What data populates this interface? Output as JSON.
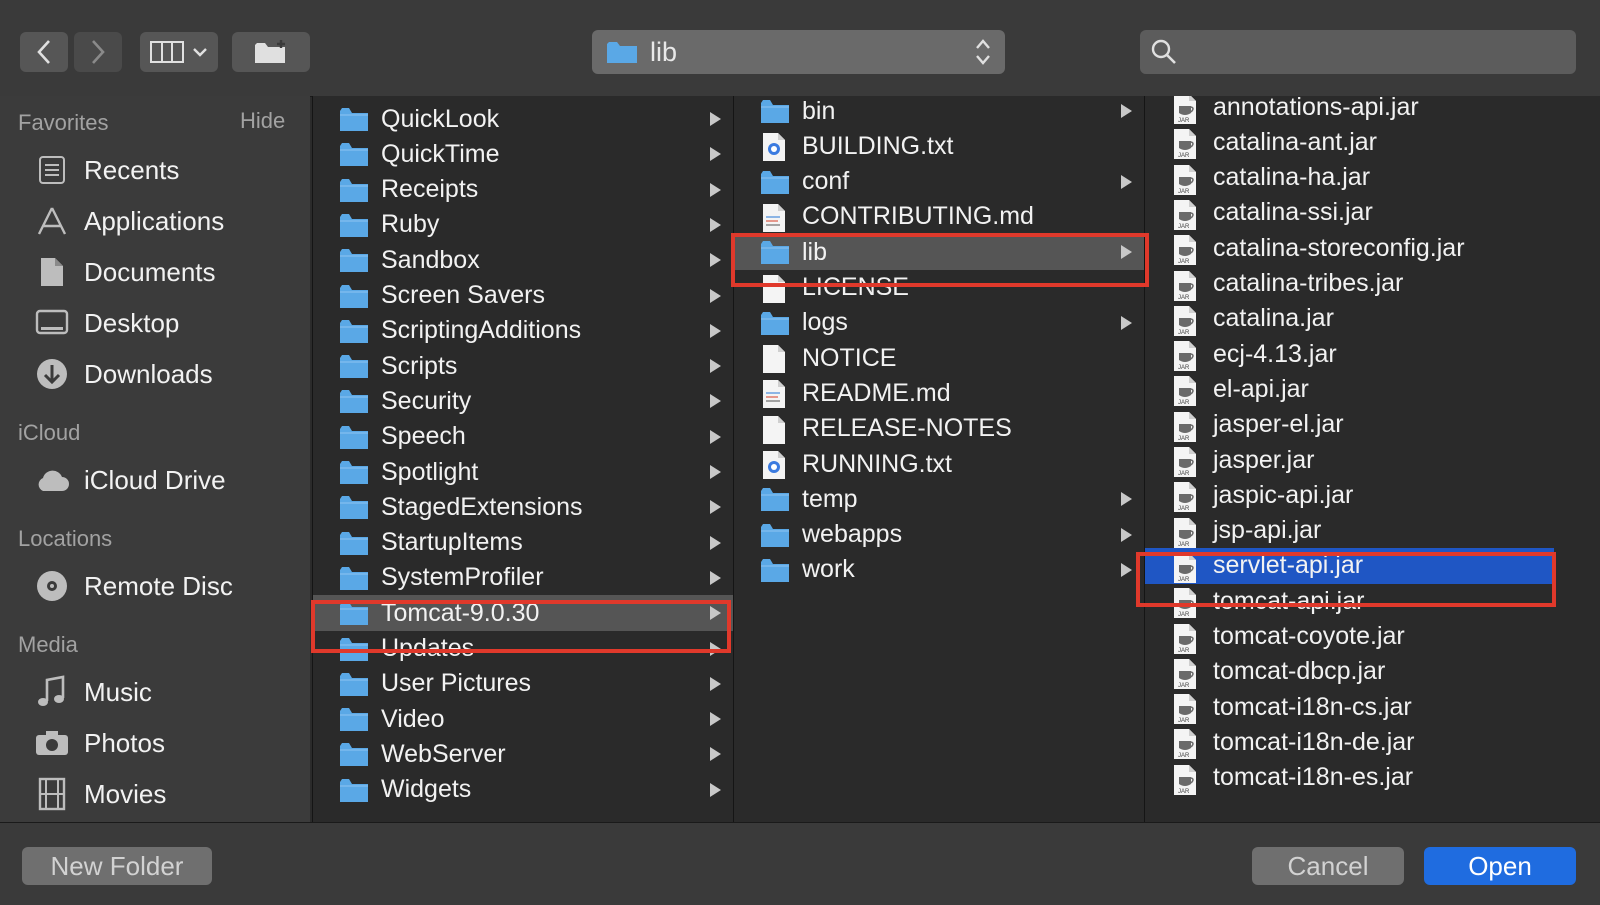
{
  "toolbar": {
    "path_label": "lib",
    "search_placeholder": ""
  },
  "sidebar": {
    "favorites_title": "Favorites",
    "hide_label": "Hide",
    "favorites": [
      {
        "label": "Recents",
        "icon": "recents-icon"
      },
      {
        "label": "Applications",
        "icon": "applications-icon"
      },
      {
        "label": "Documents",
        "icon": "documents-icon"
      },
      {
        "label": "Desktop",
        "icon": "desktop-icon"
      },
      {
        "label": "Downloads",
        "icon": "downloads-icon"
      }
    ],
    "icloud_title": "iCloud",
    "icloud": [
      {
        "label": "iCloud Drive",
        "icon": "cloud-icon"
      }
    ],
    "locations_title": "Locations",
    "locations": [
      {
        "label": "Remote Disc",
        "icon": "disc-icon"
      }
    ],
    "media_title": "Media",
    "media": [
      {
        "label": "Music",
        "icon": "music-icon"
      },
      {
        "label": "Photos",
        "icon": "camera-icon"
      },
      {
        "label": "Movies",
        "icon": "film-icon"
      }
    ]
  },
  "column1": {
    "items": [
      {
        "name": "QuickLook",
        "type": "folder"
      },
      {
        "name": "QuickTime",
        "type": "folder"
      },
      {
        "name": "Receipts",
        "type": "folder"
      },
      {
        "name": "Ruby",
        "type": "folder"
      },
      {
        "name": "Sandbox",
        "type": "folder"
      },
      {
        "name": "Screen Savers",
        "type": "folder"
      },
      {
        "name": "ScriptingAdditions",
        "type": "folder"
      },
      {
        "name": "Scripts",
        "type": "folder"
      },
      {
        "name": "Security",
        "type": "folder"
      },
      {
        "name": "Speech",
        "type": "folder"
      },
      {
        "name": "Spotlight",
        "type": "folder"
      },
      {
        "name": "StagedExtensions",
        "type": "folder"
      },
      {
        "name": "StartupItems",
        "type": "folder"
      },
      {
        "name": "SystemProfiler",
        "type": "folder"
      },
      {
        "name": "Tomcat-9.0.30",
        "type": "folder",
        "selected": true
      },
      {
        "name": "Updates",
        "type": "folder"
      },
      {
        "name": "User Pictures",
        "type": "folder"
      },
      {
        "name": "Video",
        "type": "folder"
      },
      {
        "name": "WebServer",
        "type": "folder"
      },
      {
        "name": "Widgets",
        "type": "folder"
      }
    ]
  },
  "column2": {
    "items": [
      {
        "name": "bin",
        "type": "folder"
      },
      {
        "name": "BUILDING.txt",
        "type": "txt"
      },
      {
        "name": "conf",
        "type": "folder"
      },
      {
        "name": "CONTRIBUTING.md",
        "type": "md"
      },
      {
        "name": "lib",
        "type": "folder",
        "selected": true
      },
      {
        "name": "LICENSE",
        "type": "doc"
      },
      {
        "name": "logs",
        "type": "folder"
      },
      {
        "name": "NOTICE",
        "type": "doc"
      },
      {
        "name": "README.md",
        "type": "md"
      },
      {
        "name": "RELEASE-NOTES",
        "type": "doc"
      },
      {
        "name": "RUNNING.txt",
        "type": "txt"
      },
      {
        "name": "temp",
        "type": "folder"
      },
      {
        "name": "webapps",
        "type": "folder"
      },
      {
        "name": "work",
        "type": "folder"
      }
    ]
  },
  "column3": {
    "items": [
      {
        "name": "annotations-api.jar"
      },
      {
        "name": "catalina-ant.jar"
      },
      {
        "name": "catalina-ha.jar"
      },
      {
        "name": "catalina-ssi.jar"
      },
      {
        "name": "catalina-storeconfig.jar"
      },
      {
        "name": "catalina-tribes.jar"
      },
      {
        "name": "catalina.jar"
      },
      {
        "name": "ecj-4.13.jar"
      },
      {
        "name": "el-api.jar"
      },
      {
        "name": "jasper-el.jar"
      },
      {
        "name": "jasper.jar"
      },
      {
        "name": "jaspic-api.jar"
      },
      {
        "name": "jsp-api.jar"
      },
      {
        "name": "servlet-api.jar",
        "selected": true
      },
      {
        "name": "tomcat-api.jar"
      },
      {
        "name": "tomcat-coyote.jar"
      },
      {
        "name": "tomcat-dbcp.jar"
      },
      {
        "name": "tomcat-i18n-cs.jar"
      },
      {
        "name": "tomcat-i18n-de.jar"
      },
      {
        "name": "tomcat-i18n-es.jar"
      }
    ]
  },
  "buttons": {
    "new_folder": "New Folder",
    "cancel": "Cancel",
    "open": "Open"
  },
  "colors": {
    "selection_blue": "#1f56c4",
    "selection_gray": "#555555",
    "highlight_red": "#e0392b",
    "open_button": "#1f6ce0",
    "folder_blue": "#5aa8e6"
  }
}
